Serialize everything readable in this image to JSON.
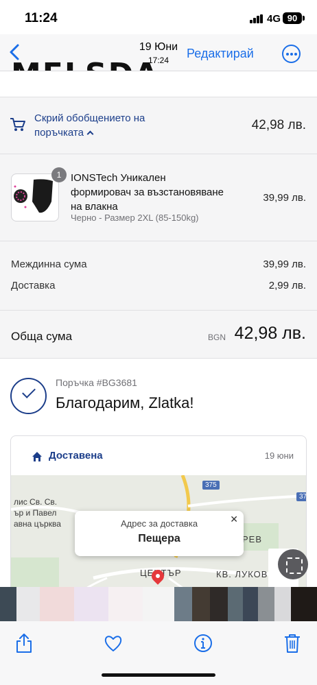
{
  "status_bar": {
    "time": "11:24",
    "network": "4G",
    "battery": "90"
  },
  "nav": {
    "date": "19 Юни",
    "time": "17:24",
    "edit_label": "Редактирай",
    "logo_peek": "MELSDA"
  },
  "summary_toggle": {
    "label": "Скрий обобщението на поръчката",
    "total": "42,98 лв."
  },
  "product": {
    "quantity": "1",
    "name": "IONSTech Уникален формировач за възстановяване на влакна",
    "variant": "Черно - Размер 2XL (85-150kg)",
    "price": "39,99 лв."
  },
  "lines": {
    "subtotal_label": "Междинна сума",
    "subtotal_value": "39,99 лв.",
    "shipping_label": "Доставка",
    "shipping_value": "2,99 лв."
  },
  "total": {
    "label": "Обща сума",
    "currency": "BGN",
    "value": "42,98 лв."
  },
  "confirmation": {
    "order_number": "Поръчка #BG3681",
    "thanks": "Благодарим, Zlatka!"
  },
  "delivery": {
    "status": "Доставена",
    "date": "19 юни",
    "map": {
      "church_line1": "лис Св. Св.",
      "church_line2": "ър и Павел",
      "church_line3": "авна църква",
      "road_375": "375",
      "road_37": "37",
      "district_center": "ЦЕНТЪР",
      "district_lukov": "КВ. ЛУКОВ",
      "district_rev": "РЕВ"
    },
    "popup": {
      "title": "Адрес за доставка",
      "city": "Пещера",
      "close": "✕"
    }
  },
  "colors": {
    "accent": "#1a6ee8",
    "brand_navy": "#1c3e8a",
    "pin": "#e5383b"
  },
  "icons": {
    "back": "chevron-left-icon",
    "more": "more-icon",
    "cart": "cart-icon",
    "home": "home-icon",
    "share": "share-icon",
    "favorite": "heart-icon",
    "info": "info-icon",
    "delete": "trash-icon",
    "scan": "scan-text-icon"
  }
}
